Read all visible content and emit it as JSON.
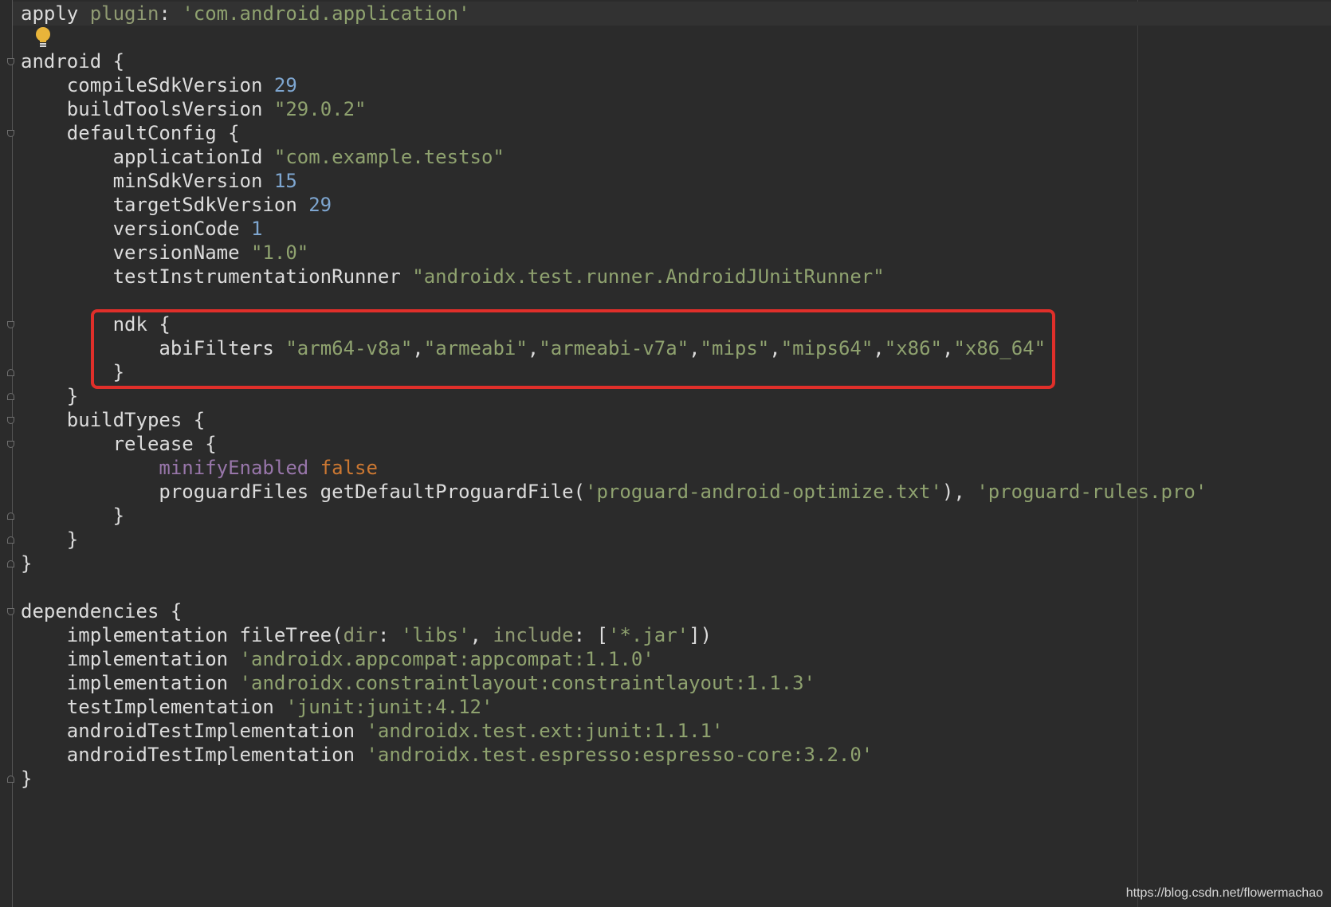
{
  "editor": {
    "watermark": "https://blog.csdn.net/flowermachao",
    "colors": {
      "background": "#2b2b2b",
      "text": "#dcdcdc",
      "string": "#8fa26f",
      "number": "#7ea6d0",
      "keyword": "#cc7832",
      "property": "#9876aa",
      "highlight_box": "#e02f2a"
    },
    "lines": [
      [
        {
          "t": "apply ",
          "c": "plain"
        },
        {
          "t": "plugin",
          "c": "named"
        },
        {
          "t": ": ",
          "c": "plain"
        },
        {
          "t": "'com.android.application'",
          "c": "str"
        }
      ],
      [],
      [
        {
          "t": "android {",
          "c": "plain"
        }
      ],
      [
        {
          "t": "    compileSdkVersion ",
          "c": "plain"
        },
        {
          "t": "29",
          "c": "num"
        }
      ],
      [
        {
          "t": "    buildToolsVersion ",
          "c": "plain"
        },
        {
          "t": "\"29.0.2\"",
          "c": "str"
        }
      ],
      [
        {
          "t": "    defaultConfig {",
          "c": "plain"
        }
      ],
      [
        {
          "t": "        applicationId ",
          "c": "plain"
        },
        {
          "t": "\"com.example.testso\"",
          "c": "str"
        }
      ],
      [
        {
          "t": "        minSdkVersion ",
          "c": "plain"
        },
        {
          "t": "15",
          "c": "num"
        }
      ],
      [
        {
          "t": "        targetSdkVersion ",
          "c": "plain"
        },
        {
          "t": "29",
          "c": "num"
        }
      ],
      [
        {
          "t": "        versionCode ",
          "c": "plain"
        },
        {
          "t": "1",
          "c": "num"
        }
      ],
      [
        {
          "t": "        versionName ",
          "c": "plain"
        },
        {
          "t": "\"1.0\"",
          "c": "str"
        }
      ],
      [
        {
          "t": "        testInstrumentationRunner ",
          "c": "plain"
        },
        {
          "t": "\"androidx.test.runner.AndroidJUnitRunner\"",
          "c": "str"
        }
      ],
      [],
      [
        {
          "t": "        ndk {",
          "c": "plain"
        }
      ],
      [
        {
          "t": "            abiFilters ",
          "c": "plain"
        },
        {
          "t": "\"arm64-v8a\"",
          "c": "str"
        },
        {
          "t": ",",
          "c": "plain"
        },
        {
          "t": "\"armeabi\"",
          "c": "str"
        },
        {
          "t": ",",
          "c": "plain"
        },
        {
          "t": "\"armeabi-v7a\"",
          "c": "str"
        },
        {
          "t": ",",
          "c": "plain"
        },
        {
          "t": "\"mips\"",
          "c": "str"
        },
        {
          "t": ",",
          "c": "plain"
        },
        {
          "t": "\"mips64\"",
          "c": "str"
        },
        {
          "t": ",",
          "c": "plain"
        },
        {
          "t": "\"x86\"",
          "c": "str"
        },
        {
          "t": ",",
          "c": "plain"
        },
        {
          "t": "\"x86_64\"",
          "c": "str"
        }
      ],
      [
        {
          "t": "        }",
          "c": "plain"
        }
      ],
      [
        {
          "t": "    }",
          "c": "plain"
        }
      ],
      [
        {
          "t": "    buildTypes {",
          "c": "plain"
        }
      ],
      [
        {
          "t": "        release {",
          "c": "plain"
        }
      ],
      [
        {
          "t": "            ",
          "c": "plain"
        },
        {
          "t": "minifyEnabled ",
          "c": "prop"
        },
        {
          "t": "false",
          "c": "kw"
        }
      ],
      [
        {
          "t": "            proguardFiles getDefaultProguardFile(",
          "c": "plain"
        },
        {
          "t": "'proguard-android-optimize.txt'",
          "c": "str"
        },
        {
          "t": "), ",
          "c": "plain"
        },
        {
          "t": "'proguard-rules.pro'",
          "c": "str"
        }
      ],
      [
        {
          "t": "        }",
          "c": "plain"
        }
      ],
      [
        {
          "t": "    }",
          "c": "plain"
        }
      ],
      [
        {
          "t": "}",
          "c": "plain"
        }
      ],
      [],
      [
        {
          "t": "dependencies {",
          "c": "plain"
        }
      ],
      [
        {
          "t": "    implementation fileTree(",
          "c": "plain"
        },
        {
          "t": "dir",
          "c": "named"
        },
        {
          "t": ": ",
          "c": "plain"
        },
        {
          "t": "'libs'",
          "c": "str"
        },
        {
          "t": ", ",
          "c": "plain"
        },
        {
          "t": "include",
          "c": "named"
        },
        {
          "t": ": [",
          "c": "plain"
        },
        {
          "t": "'*.jar'",
          "c": "str"
        },
        {
          "t": "])",
          "c": "plain"
        }
      ],
      [
        {
          "t": "    implementation ",
          "c": "plain"
        },
        {
          "t": "'androidx.appcompat:appcompat:1.1.0'",
          "c": "str"
        }
      ],
      [
        {
          "t": "    implementation ",
          "c": "plain"
        },
        {
          "t": "'androidx.constraintlayout:constraintlayout:1.1.3'",
          "c": "str"
        }
      ],
      [
        {
          "t": "    testImplementation ",
          "c": "plain"
        },
        {
          "t": "'junit:junit:4.12'",
          "c": "str"
        }
      ],
      [
        {
          "t": "    androidTestImplementation ",
          "c": "plain"
        },
        {
          "t": "'androidx.test.ext:junit:1.1.1'",
          "c": "str"
        }
      ],
      [
        {
          "t": "    androidTestImplementation ",
          "c": "plain"
        },
        {
          "t": "'androidx.test.espresso:espresso-core:3.2.0'",
          "c": "str"
        }
      ],
      [
        {
          "t": "}",
          "c": "plain"
        }
      ]
    ],
    "fold_markers": [
      {
        "line": 2,
        "kind": "open"
      },
      {
        "line": 5,
        "kind": "open"
      },
      {
        "line": 13,
        "kind": "open"
      },
      {
        "line": 15,
        "kind": "close"
      },
      {
        "line": 16,
        "kind": "close"
      },
      {
        "line": 17,
        "kind": "open"
      },
      {
        "line": 18,
        "kind": "open"
      },
      {
        "line": 21,
        "kind": "close"
      },
      {
        "line": 22,
        "kind": "close"
      },
      {
        "line": 23,
        "kind": "close"
      },
      {
        "line": 25,
        "kind": "open"
      },
      {
        "line": 32,
        "kind": "close"
      }
    ]
  }
}
